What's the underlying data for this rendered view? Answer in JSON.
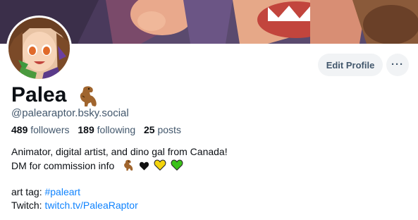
{
  "profile": {
    "display_name": "Palea",
    "handle": "@palearaptor.bsky.social",
    "avatar_icon": "avatar-icon",
    "banner_icon": "banner-image"
  },
  "stats": {
    "followers_count": "489",
    "followers_label": "followers",
    "following_count": "189",
    "following_label": "following",
    "posts_count": "25",
    "posts_label": "posts"
  },
  "actions": {
    "edit_profile_label": "Edit Profile",
    "more_label": "···"
  },
  "bio": {
    "line1": "Animator, digital artist, and dino gal from Canada!",
    "line2": "DM for commission info",
    "line2_emojis": [
      "t-rex-icon",
      "black-heart-icon",
      "yellow-heart-icon",
      "green-heart-icon"
    ],
    "art_tag_label": "art tag: ",
    "art_tag_link": "#paleart",
    "twitch_label": "Twitch: ",
    "twitch_link": "twitch.tv/PaleaRaptor"
  },
  "colors": {
    "link": "#1083fe",
    "muted": "#42576c",
    "text": "#0b0f14",
    "button_bg": "#f1f3f5"
  }
}
